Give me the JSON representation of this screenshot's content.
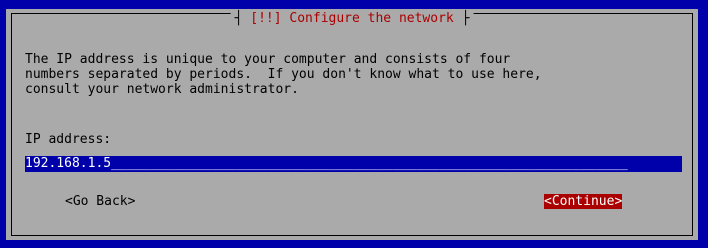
{
  "dialog": {
    "title": "[!!] Configure the network",
    "description": "The IP address is unique to your computer and consists of four\nnumbers separated by periods.  If you don't know what to use here,\nconsult your network administrator.",
    "field_label": "IP address:",
    "ip_value": "192.168.1.5",
    "input_fill": "__________________________________________________________________",
    "buttons": {
      "back": "<Go Back>",
      "continue": "<Continue>"
    }
  },
  "colors": {
    "background": "#0000aa",
    "dialog": "#aaaaaa",
    "title_text": "#aa0000",
    "input_background": "#0000aa",
    "selected_button": "#aa0000"
  }
}
